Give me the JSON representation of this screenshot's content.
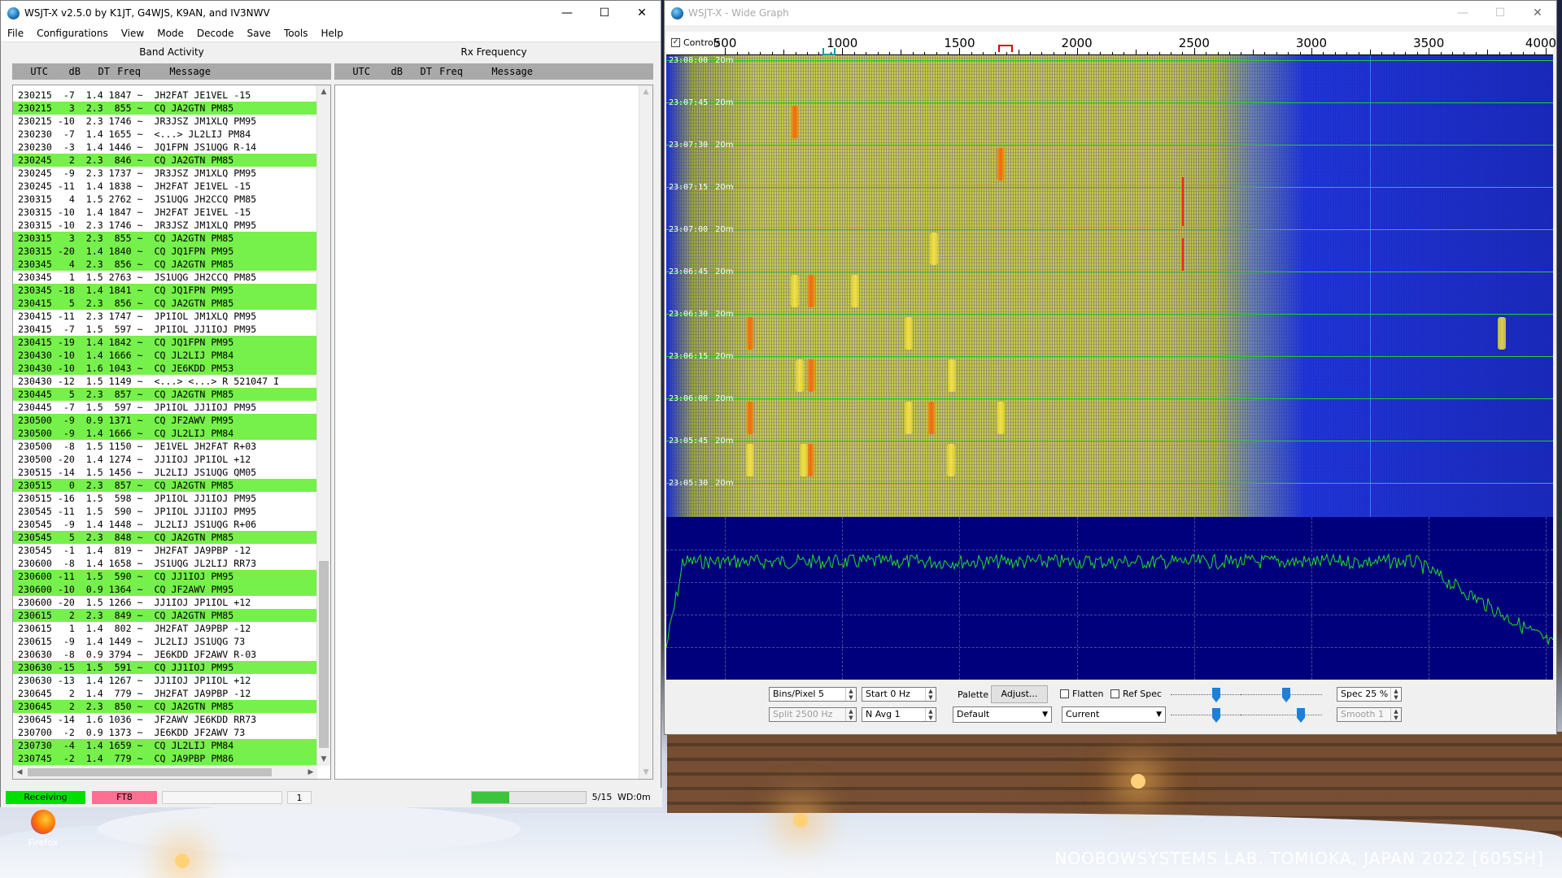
{
  "desktop": {
    "watermark": "NOOBOWSYSTEMS LAB. TOMIOKA, JAPAN 2022 [605SH]",
    "icon_label": "Firefox"
  },
  "left_window": {
    "title": "WSJT-X   v2.5.0   by K1JT, G4WJS, K9AN, and IV3NWV",
    "menu": [
      "File",
      "Configurations",
      "View",
      "Mode",
      "Decode",
      "Save",
      "Tools",
      "Help"
    ],
    "band_activity_label": "Band Activity",
    "rx_frequency_label": "Rx Frequency",
    "columns": {
      "utc": "UTC",
      "db": "dB",
      "dt": "DT",
      "freq": "Freq",
      "message": "Message"
    },
    "rows": [
      {
        "utc": "230215",
        "db": "-7",
        "dt": "1.4",
        "freq": "1847",
        "msg": "JH2FAT JE1VEL -15",
        "cq": false
      },
      {
        "utc": "230215",
        "db": "3",
        "dt": "2.3",
        "freq": "855",
        "msg": "CQ JA2GTN PM85",
        "cq": true
      },
      {
        "utc": "230215",
        "db": "-10",
        "dt": "2.3",
        "freq": "1746",
        "msg": "JR3JSZ JM1XLQ PM95",
        "cq": false
      },
      {
        "utc": "230230",
        "db": "-7",
        "dt": "1.4",
        "freq": "1655",
        "msg": "<...> JL2LIJ PM84",
        "cq": false
      },
      {
        "utc": "230230",
        "db": "-3",
        "dt": "1.4",
        "freq": "1446",
        "msg": "JQ1FPN JS1UQG R-14",
        "cq": false
      },
      {
        "utc": "230245",
        "db": "2",
        "dt": "2.3",
        "freq": "846",
        "msg": "CQ JA2GTN PM85",
        "cq": true
      },
      {
        "utc": "230245",
        "db": "-9",
        "dt": "2.3",
        "freq": "1737",
        "msg": "JR3JSZ JM1XLQ PM95",
        "cq": false
      },
      {
        "utc": "230245",
        "db": "-11",
        "dt": "1.4",
        "freq": "1838",
        "msg": "JH2FAT JE1VEL -15",
        "cq": false
      },
      {
        "utc": "230315",
        "db": "4",
        "dt": "1.5",
        "freq": "2762",
        "msg": "JS1UQG JH2CCQ PM85",
        "cq": false
      },
      {
        "utc": "230315",
        "db": "-10",
        "dt": "1.4",
        "freq": "1847",
        "msg": "JH2FAT JE1VEL -15",
        "cq": false
      },
      {
        "utc": "230315",
        "db": "-10",
        "dt": "2.3",
        "freq": "1746",
        "msg": "JR3JSZ JM1XLQ PM95",
        "cq": false
      },
      {
        "utc": "230315",
        "db": "3",
        "dt": "2.3",
        "freq": "855",
        "msg": "CQ JA2GTN PM85",
        "cq": true
      },
      {
        "utc": "230315",
        "db": "-20",
        "dt": "1.4",
        "freq": "1840",
        "msg": "CQ JQ1FPN PM95",
        "cq": true
      },
      {
        "utc": "230345",
        "db": "4",
        "dt": "2.3",
        "freq": "856",
        "msg": "CQ JA2GTN PM85",
        "cq": true
      },
      {
        "utc": "230345",
        "db": "1",
        "dt": "1.5",
        "freq": "2763",
        "msg": "JS1UQG JH2CCQ PM85",
        "cq": false
      },
      {
        "utc": "230345",
        "db": "-18",
        "dt": "1.4",
        "freq": "1841",
        "msg": "CQ JQ1FPN PM95",
        "cq": true
      },
      {
        "utc": "230415",
        "db": "5",
        "dt": "2.3",
        "freq": "856",
        "msg": "CQ JA2GTN PM85",
        "cq": true
      },
      {
        "utc": "230415",
        "db": "-11",
        "dt": "2.3",
        "freq": "1747",
        "msg": "JP1IOL JM1XLQ PM95",
        "cq": false
      },
      {
        "utc": "230415",
        "db": "-7",
        "dt": "1.5",
        "freq": "597",
        "msg": "JP1IOL JJ1IOJ PM95",
        "cq": false
      },
      {
        "utc": "230415",
        "db": "-19",
        "dt": "1.4",
        "freq": "1842",
        "msg": "CQ JQ1FPN PM95",
        "cq": true
      },
      {
        "utc": "230430",
        "db": "-10",
        "dt": "1.4",
        "freq": "1666",
        "msg": "CQ JL2LIJ PM84",
        "cq": true
      },
      {
        "utc": "230430",
        "db": "-10",
        "dt": "1.6",
        "freq": "1043",
        "msg": "CQ JE6KDD PM53",
        "cq": true
      },
      {
        "utc": "230430",
        "db": "-12",
        "dt": "1.5",
        "freq": "1149",
        "msg": "<...> <...> R 521047 I",
        "cq": false
      },
      {
        "utc": "230445",
        "db": "5",
        "dt": "2.3",
        "freq": "857",
        "msg": "CQ JA2GTN PM85",
        "cq": true
      },
      {
        "utc": "230445",
        "db": "-7",
        "dt": "1.5",
        "freq": "597",
        "msg": "JP1IOL JJ1IOJ PM95",
        "cq": false
      },
      {
        "utc": "230500",
        "db": "-9",
        "dt": "0.9",
        "freq": "1371",
        "msg": "CQ JF2AWV PM95",
        "cq": true
      },
      {
        "utc": "230500",
        "db": "-9",
        "dt": "1.4",
        "freq": "1666",
        "msg": "CQ JL2LIJ PM84",
        "cq": true
      },
      {
        "utc": "230500",
        "db": "-8",
        "dt": "1.5",
        "freq": "1150",
        "msg": "JE1VEL JH2FAT R+03",
        "cq": false
      },
      {
        "utc": "230500",
        "db": "-20",
        "dt": "1.4",
        "freq": "1274",
        "msg": "JJ1IOJ JP1IOL +12",
        "cq": false
      },
      {
        "utc": "230515",
        "db": "-14",
        "dt": "1.5",
        "freq": "1456",
        "msg": "JL2LIJ JS1UQG QM05",
        "cq": false
      },
      {
        "utc": "230515",
        "db": "0",
        "dt": "2.3",
        "freq": "857",
        "msg": "CQ JA2GTN PM85",
        "cq": true
      },
      {
        "utc": "230515",
        "db": "-16",
        "dt": "1.5",
        "freq": "598",
        "msg": "JP1IOL JJ1IOJ PM95",
        "cq": false
      },
      {
        "utc": "230545",
        "db": "-11",
        "dt": "1.5",
        "freq": "590",
        "msg": "JP1IOL JJ1IOJ PM95",
        "cq": false
      },
      {
        "utc": "230545",
        "db": "-9",
        "dt": "1.4",
        "freq": "1448",
        "msg": "JL2LIJ JS1UQG R+06",
        "cq": false
      },
      {
        "utc": "230545",
        "db": "5",
        "dt": "2.3",
        "freq": "848",
        "msg": "CQ JA2GTN PM85",
        "cq": true
      },
      {
        "utc": "230545",
        "db": "-1",
        "dt": "1.4",
        "freq": "819",
        "msg": "JH2FAT JA9PBP -12",
        "cq": false
      },
      {
        "utc": "230600",
        "db": "-8",
        "dt": "1.4",
        "freq": "1658",
        "msg": "JS1UQG JL2LIJ RR73",
        "cq": false
      },
      {
        "utc": "230600",
        "db": "-11",
        "dt": "1.5",
        "freq": "590",
        "msg": "CQ JJ1IOJ PM95",
        "cq": true
      },
      {
        "utc": "230600",
        "db": "-10",
        "dt": "0.9",
        "freq": "1364",
        "msg": "CQ JF2AWV PM95",
        "cq": true
      },
      {
        "utc": "230600",
        "db": "-20",
        "dt": "1.5",
        "freq": "1266",
        "msg": "JJ1IOJ JP1IOL +12",
        "cq": false
      },
      {
        "utc": "230615",
        "db": "2",
        "dt": "2.3",
        "freq": "849",
        "msg": "CQ JA2GTN PM85",
        "cq": true
      },
      {
        "utc": "230615",
        "db": "1",
        "dt": "1.4",
        "freq": "802",
        "msg": "JH2FAT JA9PBP -12",
        "cq": false
      },
      {
        "utc": "230615",
        "db": "-9",
        "dt": "1.4",
        "freq": "1449",
        "msg": "JL2LIJ JS1UQG 73",
        "cq": false
      },
      {
        "utc": "230630",
        "db": "-8",
        "dt": "0.9",
        "freq": "3794",
        "msg": "JE6KDD JF2AWV R-03",
        "cq": false
      },
      {
        "utc": "230630",
        "db": "-15",
        "dt": "1.5",
        "freq": "591",
        "msg": "CQ JJ1IOJ PM95",
        "cq": true
      },
      {
        "utc": "230630",
        "db": "-13",
        "dt": "1.4",
        "freq": "1267",
        "msg": "JJ1IOJ JP1IOL +12",
        "cq": false
      },
      {
        "utc": "230645",
        "db": "2",
        "dt": "1.4",
        "freq": "779",
        "msg": "JH2FAT JA9PBP -12",
        "cq": false
      },
      {
        "utc": "230645",
        "db": "2",
        "dt": "2.3",
        "freq": "850",
        "msg": "CQ JA2GTN PM85",
        "cq": true
      },
      {
        "utc": "230645",
        "db": "-14",
        "dt": "1.6",
        "freq": "1036",
        "msg": "JF2AWV JE6KDD RR73",
        "cq": false
      },
      {
        "utc": "230700",
        "db": "-2",
        "dt": "0.9",
        "freq": "1373",
        "msg": "JE6KDD JF2AWV 73",
        "cq": false
      },
      {
        "utc": "230730",
        "db": "-4",
        "dt": "1.4",
        "freq": "1659",
        "msg": "CQ JL2LIJ PM84",
        "cq": true
      },
      {
        "utc": "230745",
        "db": "-2",
        "dt": "1.4",
        "freq": "779",
        "msg": "CQ JA9PBP PM86",
        "cq": true
      }
    ],
    "status": {
      "receiving": "Receiving",
      "mode": "FT8",
      "blank": "",
      "count": "1",
      "progress_fraction": 0.33,
      "period": "5/15",
      "wd": "WD:0m"
    },
    "colors": {
      "cq_highlight": "#76f04a",
      "receiving": "#00e000",
      "mode": "#ff6f91",
      "progress": "#3cc43c"
    }
  },
  "right_window": {
    "title": "WSJT-X - Wide Graph",
    "controls_label": "Controls",
    "controls_checked": true,
    "freq_scale": [
      500,
      1000,
      1500,
      2000,
      2500,
      3000,
      3500,
      4000
    ],
    "time_labels": [
      "23:08:00",
      "23:07:45",
      "23:07:30",
      "23:07:15",
      "23:07:00",
      "23:06:45",
      "23:06:30",
      "23:06:15",
      "23:06:00",
      "23:05:45",
      "23:05:30"
    ],
    "band_label": "20m",
    "controls": {
      "bins_pixel": "Bins/Pixel  5",
      "start": "Start  0 Hz",
      "palette_label": "Palette",
      "adjust": "Adjust...",
      "flatten": "Flatten",
      "ref_spec": "Ref Spec",
      "spec": "Spec  25 %",
      "split": "Split   2500   Hz",
      "n_avg": "N Avg  1",
      "palette_value": "Default",
      "spectrum_value": "Current",
      "smooth": "Smooth   1"
    }
  }
}
